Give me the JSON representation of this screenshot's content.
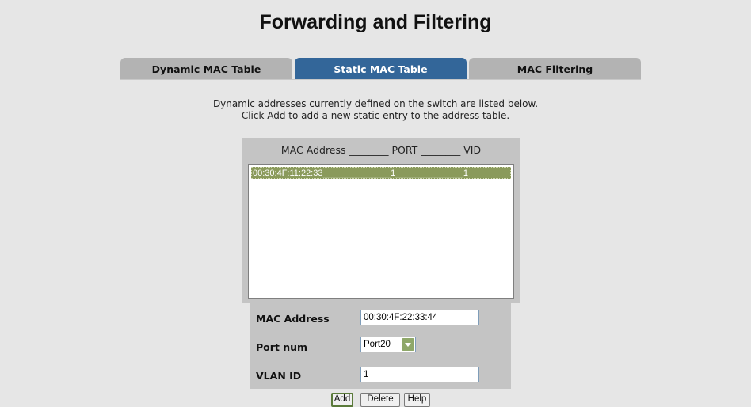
{
  "page": {
    "title": "Forwarding and Filtering"
  },
  "tabs": [
    {
      "label": "Dynamic MAC Table",
      "active": false
    },
    {
      "label": "Static MAC Table",
      "active": true
    },
    {
      "label": "MAC Filtering",
      "active": false
    }
  ],
  "description": {
    "line1": "Dynamic addresses currently defined on the switch are listed below.",
    "line2": "Click Add to add a new static entry to the address table."
  },
  "list": {
    "header": "MAC Address ________ PORT ________ VID",
    "rows": [
      "00:30:4F:11:22:33______________1______________1"
    ],
    "selected_row": 0
  },
  "form": {
    "mac_label": "MAC Address",
    "mac_value": "00:30:4F:22:33:44",
    "port_label": "Port num",
    "port_value": "Port20",
    "vlan_label": "VLAN ID",
    "vlan_value": "1"
  },
  "buttons": {
    "add": "Add",
    "delete": "Delete",
    "help": "Help"
  },
  "colors": {
    "active_tab": "#336699",
    "inactive_tab": "#b3b3b3",
    "selection": "#8a9a5b",
    "panel": "#c4c4c4",
    "background": "#e6e6e6"
  },
  "icons": {
    "dropdown": "chevron-down-icon"
  }
}
